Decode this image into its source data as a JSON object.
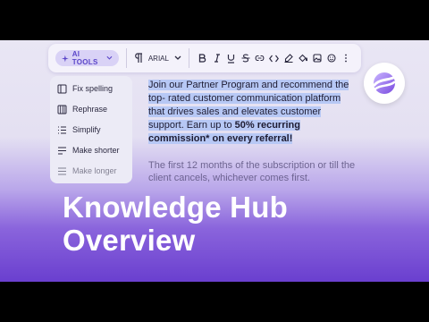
{
  "toolbar": {
    "ai_tools_label": "AI TOOLS",
    "font_name": "ARIAL",
    "icons": [
      "paragraph-icon",
      "bold-icon",
      "italic-icon",
      "underline-icon",
      "strikethrough-icon",
      "link-icon",
      "code-icon",
      "highlight-icon",
      "fill-icon",
      "image-icon",
      "emoji-icon",
      "more-icon"
    ]
  },
  "ai_menu": {
    "items": [
      {
        "label": "Fix spelling",
        "icon": "spellcheck-icon"
      },
      {
        "label": "Rephrase",
        "icon": "rephrase-icon"
      },
      {
        "label": "Simplify",
        "icon": "simplify-icon"
      },
      {
        "label": "Make shorter",
        "icon": "shorter-icon"
      },
      {
        "label": "Make longer",
        "icon": "longer-icon"
      }
    ]
  },
  "document": {
    "selected_text": "Join our Partner Program and recommend the top- rated customer communication platform that drives sales and elevates customer support. Earn up to ",
    "selected_bold": "50% recurring commission* on every referral!",
    "second_paragraph": "The first 12 months of the subscription or till the client cancels, whichever comes first."
  },
  "headline": {
    "line1": "Knowledge Hub",
    "line2": "Overview"
  },
  "colors": {
    "accent": "#6a3fcf",
    "selection": "#b7c8f5",
    "pill": "#d9d2f6"
  }
}
